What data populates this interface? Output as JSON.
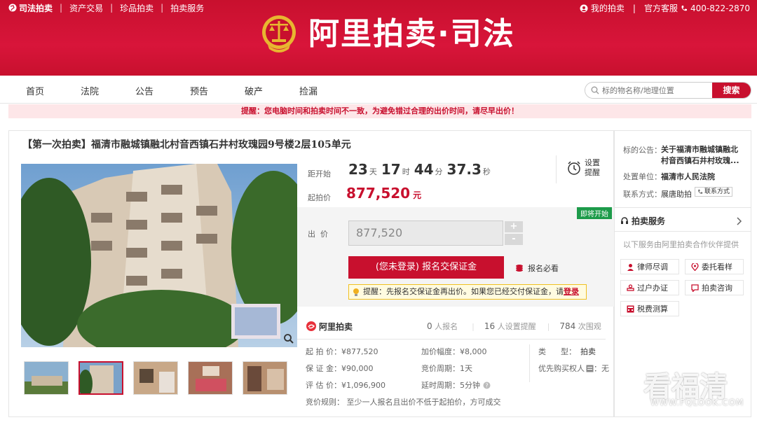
{
  "topbar": {
    "brand": "司法拍卖",
    "links": [
      "资产交易",
      "珍品拍卖",
      "拍卖服务"
    ],
    "my_auction": "我的拍卖",
    "support": "官方客服",
    "phone": "400-822-2870"
  },
  "logo": {
    "text": "阿里拍卖·司法"
  },
  "nav": {
    "items": [
      "首页",
      "法院",
      "公告",
      "预告",
      "破产",
      "捡漏"
    ]
  },
  "search": {
    "placeholder": "标的物名称/地理位置",
    "button": "搜索"
  },
  "warning": "提醒：您电脑时间和拍卖时间不一致，为避免错过合理的出价时间，请尽早出价！",
  "item": {
    "title": "【第一次拍卖】福清市融城镇融北村音西镇石井村玫瑰园9号楼2层105单元"
  },
  "countdown": {
    "label": "距开始",
    "days": "23",
    "days_unit": "天",
    "hours": "17",
    "hours_unit": "时",
    "minutes": "44",
    "minutes_unit": "分",
    "seconds": "37.3",
    "seconds_unit": "秒"
  },
  "start_price": {
    "label": "起拍价",
    "value": "877,520",
    "unit": "元"
  },
  "remind": {
    "line1": "设置",
    "line2": "提醒"
  },
  "badge": "即将开始",
  "bid": {
    "label": "出  价",
    "value": "877,520",
    "plus": "+",
    "minus": "-"
  },
  "register": {
    "button": "(您未登录) 报名交保证金",
    "guide": "报名必看"
  },
  "tip": {
    "text": "提醒：先报名交保证金再出价。如果您已经交付保证金，请",
    "link": "登录"
  },
  "stats": {
    "brand": "阿里拍卖",
    "signup_count": "0",
    "signup_label": "人报名",
    "remind_count": "16",
    "remind_label": "人设置提醒",
    "view_count": "784",
    "view_label": "次围观"
  },
  "details": {
    "start_price": "起 拍 价：¥877,520",
    "deposit": "保 证 金：¥90,000",
    "appraisal": "评 估 价：¥1,096,900",
    "increment": "加价幅度：¥8,000",
    "cycle": "竞价周期：1天",
    "delay": "延时周期：5分钟",
    "type_label": "类      型：",
    "type_value": "拍卖",
    "priority": "优先购买权人",
    "priority_value": "：无",
    "rule": "竞价规则：  至少一人报名且出价不低于起拍价，方可成交"
  },
  "side": {
    "notice_label": "标的公告：",
    "notice_value": "关于福清市融城镇融北村音西镇石井村玫瑰...",
    "unit_label": "处置单位：",
    "unit_value": "福清市人民法院",
    "contact_label": "联系方式：",
    "contact_value": "展唐助拍",
    "contact_btn": "联系方式",
    "service_title": "拍卖服务",
    "service_desc": "以下服务由阿里拍卖合作伙伴提供",
    "services": [
      "律师尽调",
      "委托看样",
      "过户办证",
      "拍卖咨询",
      "税费测算"
    ]
  },
  "watermark": {
    "big": "看福清",
    "small": "WWW.FQLOOK.COM"
  },
  "colors": {
    "brand_red": "#c8102e",
    "green": "#1d9b4a"
  }
}
